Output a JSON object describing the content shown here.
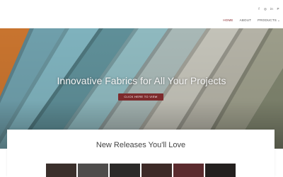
{
  "header": {
    "social": [
      {
        "icon": "facebook-icon",
        "glyph": "f"
      },
      {
        "icon": "instagram-icon",
        "glyph": "◎"
      },
      {
        "icon": "linkedin-icon",
        "glyph": "in"
      },
      {
        "icon": "pinterest-icon",
        "glyph": "P"
      }
    ],
    "nav": [
      {
        "label": "HOME",
        "active": true
      },
      {
        "label": "ABOUT",
        "active": false
      },
      {
        "label": "PRODUCTS",
        "active": false
      }
    ],
    "products_chevron": "⌄"
  },
  "hero": {
    "title": "Innovative Fabrics for All Your Projects",
    "button_label": "CLICK HERE TO VIEW"
  },
  "new_releases": {
    "title": "New Releases You'll Love",
    "swatch_colors": [
      "#3a2f2b",
      "#4e4c4b",
      "#2c2a29",
      "#3d2a27",
      "#5b2b2e",
      "#24201f"
    ]
  },
  "colors": {
    "accent": "#7d2a2c",
    "active_nav": "#8a2a2e",
    "fabric_orange": "#c8742f",
    "fabric_teal": "#6aa0ac",
    "fabric_stone": "#b9b8ad",
    "fabric_sage": "#8c9075"
  }
}
